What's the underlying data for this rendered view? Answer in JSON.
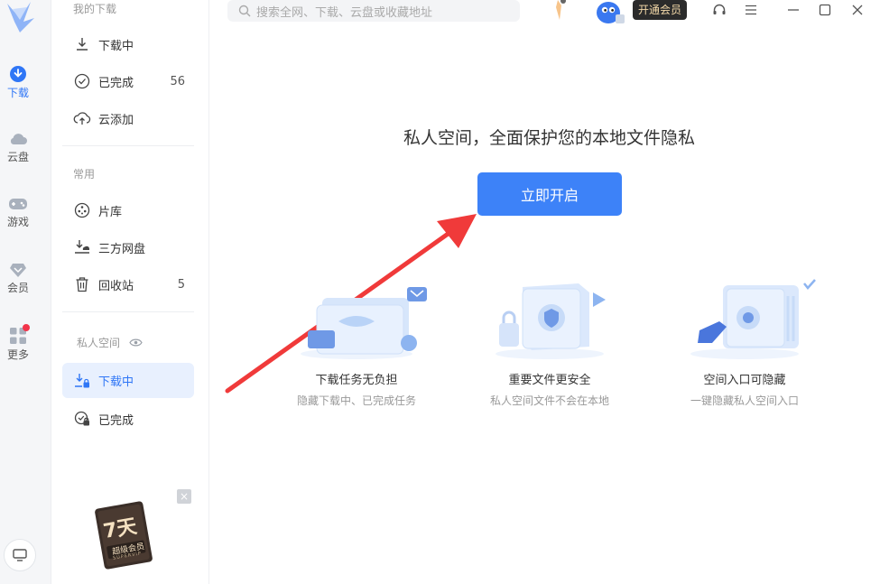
{
  "rail": {
    "items": [
      {
        "label": "下载",
        "icon": "download-icon"
      },
      {
        "label": "云盘",
        "icon": "cloud-icon"
      },
      {
        "label": "游戏",
        "icon": "gamepad-icon"
      },
      {
        "label": "会员",
        "icon": "diamond-icon"
      },
      {
        "label": "更多",
        "icon": "apps-icon"
      }
    ]
  },
  "sidebar": {
    "my_downloads_title": "我的下载",
    "downloading": "下载中",
    "completed": "已完成",
    "completed_count": "56",
    "cloud_add": "云添加",
    "common_title": "常用",
    "library": "片库",
    "third_party_disk": "三方网盘",
    "recycle_bin": "回收站",
    "recycle_count": "5",
    "private_title": "私人空间",
    "private_downloading": "下载中",
    "private_completed": "已完成"
  },
  "topbar": {
    "search_placeholder": "搜索全网、下载、云盘或收藏地址",
    "vip_button": "开通会员"
  },
  "main": {
    "title": "私人空间，全面保护您的本地文件隐私",
    "start_button": "立即开启",
    "features": [
      {
        "title": "下载任务无负担",
        "desc": "隐藏下载中、已完成任务"
      },
      {
        "title": "重要文件更安全",
        "desc": "私人空间文件不会在本地"
      },
      {
        "title": "空间入口可隐藏",
        "desc": "一键隐藏私人空间入口"
      }
    ]
  },
  "promo": {
    "days": "7天",
    "label": "超级会员",
    "sub": "SUPERVIP"
  },
  "colors": {
    "accent": "#3d82f8",
    "arrow": "#f03a3a",
    "badge": "#f2344a"
  }
}
